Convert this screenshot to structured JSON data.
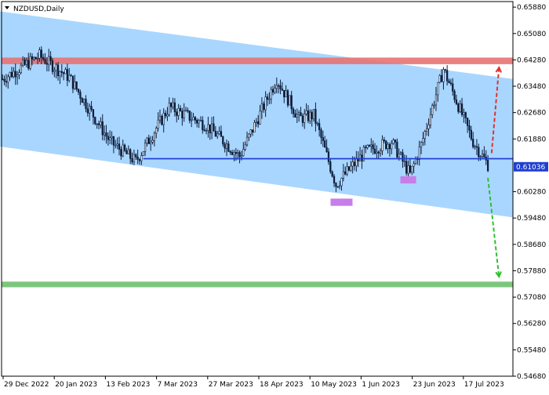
{
  "window": {
    "title": "NZDUSD,Daily"
  },
  "colors": {
    "channel": "#a9d6ff",
    "bull_body": "#ffffff",
    "bear_body": "#0b1e3c",
    "wick": "#0b1e3c",
    "resistance_zone": "#e57373",
    "target_zone": "#6fbf6f",
    "support_line": "#1f3fd0",
    "price_label_bg": "#1f3fd0",
    "up_arrow": "#e03030",
    "down_arrow": "#2fbf2f",
    "marker": "#c77ee8"
  },
  "chart_data": {
    "type": "candlestick",
    "symbol": "NZDUSD",
    "timeframe": "Daily",
    "ylim": [
      0.5468,
      0.6605
    ],
    "y_ticks": [
      "0.65880",
      "0.65080",
      "0.64280",
      "0.63480",
      "0.62680",
      "0.61880",
      "0.61036",
      "0.60280",
      "0.59480",
      "0.58680",
      "0.57880",
      "0.57080",
      "0.56280",
      "0.55480",
      "0.54680"
    ],
    "current_price": "0.61036",
    "x_labels": [
      "29 Dec 2022",
      "20 Jan 2023",
      "13 Feb 2023",
      "7 Mar 2023",
      "27 Mar 2023",
      "18 Apr 2023",
      "10 May 2023",
      "1 Jun 2023",
      "23 Jun 2023",
      "17 Jul 2023"
    ],
    "key_closes": [
      {
        "x": 0,
        "y": 0.637
      },
      {
        "x": 20,
        "y": 0.644
      },
      {
        "x": 36,
        "y": 0.6375
      },
      {
        "x": 58,
        "y": 0.618
      },
      {
        "x": 72,
        "y": 0.612
      },
      {
        "x": 90,
        "y": 0.6285
      },
      {
        "x": 110,
        "y": 0.623
      },
      {
        "x": 128,
        "y": 0.6135
      },
      {
        "x": 148,
        "y": 0.637
      },
      {
        "x": 160,
        "y": 0.625
      },
      {
        "x": 168,
        "y": 0.626
      },
      {
        "x": 180,
        "y": 0.605
      },
      {
        "x": 196,
        "y": 0.615
      },
      {
        "x": 210,
        "y": 0.618
      },
      {
        "x": 220,
        "y": 0.608
      },
      {
        "x": 226,
        "y": 0.617
      },
      {
        "x": 238,
        "y": 0.64
      },
      {
        "x": 254,
        "y": 0.618
      },
      {
        "x": 262,
        "y": 0.611
      }
    ],
    "channel": {
      "upper": [
        [
          0,
          0.6575
        ],
        [
          276,
          0.637
        ]
      ],
      "lower": [
        [
          0,
          0.6165
        ],
        [
          276,
          0.595
        ]
      ]
    },
    "resistance_zone": [
      0.6415,
      0.6435
    ],
    "support_level": 0.6128,
    "target_zone": [
      0.5738,
      0.5755
    ],
    "markers": [
      {
        "x": 183,
        "y": [
          0.5985,
          0.6007
        ]
      },
      {
        "x": 219,
        "y": [
          0.6053,
          0.6075
        ]
      }
    ],
    "arrow_up": {
      "from": [
        264,
        0.6145
      ],
      "to": [
        268,
        0.6405
      ]
    },
    "arrow_down": {
      "from": [
        262,
        0.607
      ],
      "to": [
        268,
        0.577
      ]
    },
    "grid": false,
    "legend": "none"
  }
}
